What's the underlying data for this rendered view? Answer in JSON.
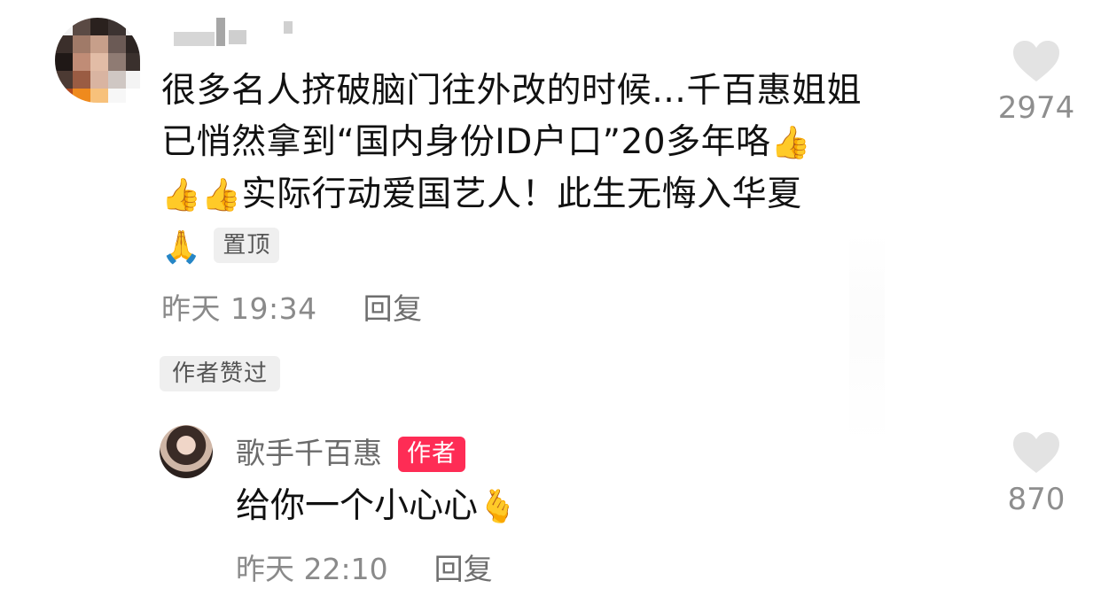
{
  "comment": {
    "lines": [
      "很多名人挤破脑门往外改的时候…千百惠姐姐",
      "已悄然拿到“国内身份ID户口”20多年咯",
      "实际行动爱国艺人！此生无悔入华夏"
    ],
    "emoji_thumbs": "👍",
    "emoji_pray": "🙏",
    "pin_label": "置顶",
    "time": "昨天 19:34",
    "reply_label": "回复",
    "liked_by_author_label": "作者赞过",
    "like_count": "2974",
    "heart_color": "#e3e3e3"
  },
  "reply": {
    "username": "歌手千百惠",
    "author_badge": "作者",
    "author_badge_color": "#fe2c55",
    "text": "给你一个小心心",
    "emoji_heart": "🫰",
    "time": "昨天 22:10",
    "reply_label": "回复",
    "like_count": "870"
  }
}
